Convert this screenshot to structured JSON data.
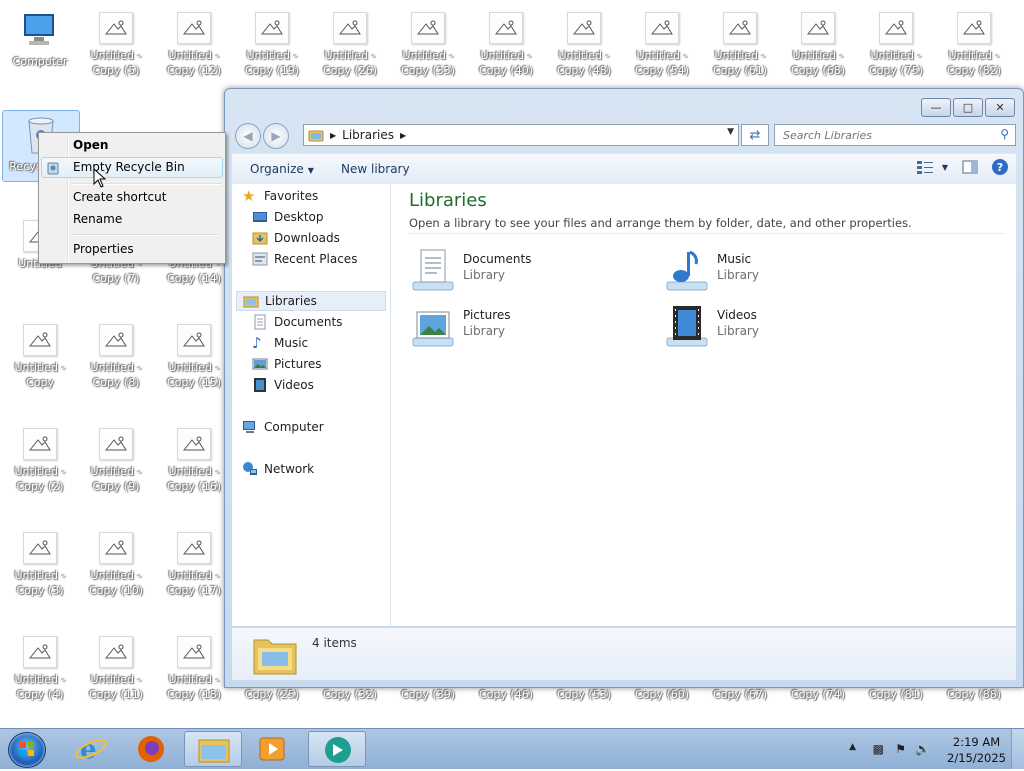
{
  "desktop": {
    "icons": [
      {
        "label": "Computer",
        "type": "computer"
      },
      {
        "label": "Untitled - Copy (5)"
      },
      {
        "label": "Untitled - Copy (12)"
      },
      {
        "label": "Untitled - Copy (19)"
      },
      {
        "label": "Untitled - Copy (26)"
      },
      {
        "label": "Untitled - Copy (33)"
      },
      {
        "label": "Untitled - Copy (40)"
      },
      {
        "label": "Untitled - Copy (48)"
      },
      {
        "label": "Untitled - Copy (54)"
      },
      {
        "label": "Untitled - Copy (61)"
      },
      {
        "label": "Untitled - Copy (68)"
      },
      {
        "label": "Untitled - Copy (75)"
      },
      {
        "label": "Untitled - Copy (82)"
      },
      {
        "label": "Recycle Bin",
        "type": "bin",
        "selected": true
      },
      {
        "label": "Untitled"
      },
      {
        "label": "Untitled - Copy (7)"
      },
      {
        "label": "Untitled - Copy (14)"
      },
      {
        "label": "Untitled - Copy"
      },
      {
        "label": "Untitled - Copy (8)"
      },
      {
        "label": "Untitled - Copy (15)"
      },
      {
        "label": "Untitled - Copy (2)"
      },
      {
        "label": "Untitled - Copy (9)"
      },
      {
        "label": "Untitled - Copy (16)"
      },
      {
        "label": "Untitled - Copy (3)"
      },
      {
        "label": "Untitled - Copy (10)"
      },
      {
        "label": "Untitled - Copy (17)"
      },
      {
        "label": "Untitled - Copy (4)"
      },
      {
        "label": "Untitled - Copy (11)"
      },
      {
        "label": "Untitled - Copy (18)"
      },
      {
        "label": "Untitled - Copy (25)"
      },
      {
        "label": "Untitled - Copy (32)"
      },
      {
        "label": "Untitled - Copy (39)"
      },
      {
        "label": "Untitled - Copy (46)"
      },
      {
        "label": "Untitled - Copy (53)"
      },
      {
        "label": "Untitled - Copy (60)"
      },
      {
        "label": "Untitled - Copy (67)"
      },
      {
        "label": "Untitled - Copy (74)"
      },
      {
        "label": "Untitled - Copy (81)"
      },
      {
        "label": "Untitled - Copy (88)"
      }
    ]
  },
  "context_menu": {
    "items": [
      "Open",
      "Empty Recycle Bin",
      "Create shortcut",
      "Rename",
      "Properties"
    ],
    "highlighted": "Empty Recycle Bin"
  },
  "explorer": {
    "address": {
      "crumb": "Libraries"
    },
    "search": {
      "placeholder": "Search Libraries"
    },
    "toolbar": {
      "organize": "Organize",
      "new_library": "New library"
    },
    "nav": {
      "favorites": "Favorites",
      "desktop": "Desktop",
      "downloads": "Downloads",
      "recent": "Recent Places",
      "libraries": "Libraries",
      "documents": "Documents",
      "music": "Music",
      "pictures": "Pictures",
      "videos": "Videos",
      "computer": "Computer",
      "network": "Network"
    },
    "heading": "Libraries",
    "subtitle": "Open a library to see your files and arrange them by folder, date, and other properties.",
    "libraries": [
      {
        "name": "Documents",
        "type": "Library"
      },
      {
        "name": "Music",
        "type": "Library"
      },
      {
        "name": "Pictures",
        "type": "Library"
      },
      {
        "name": "Videos",
        "type": "Library"
      }
    ],
    "details": {
      "count": "4 items"
    }
  },
  "taskbar": {
    "time": "2:19 AM",
    "date": "2/15/2025"
  },
  "colors": {
    "heading": "#1e6e2a",
    "selection": "#e6eef8",
    "taskbar": "#9fbcdd"
  }
}
